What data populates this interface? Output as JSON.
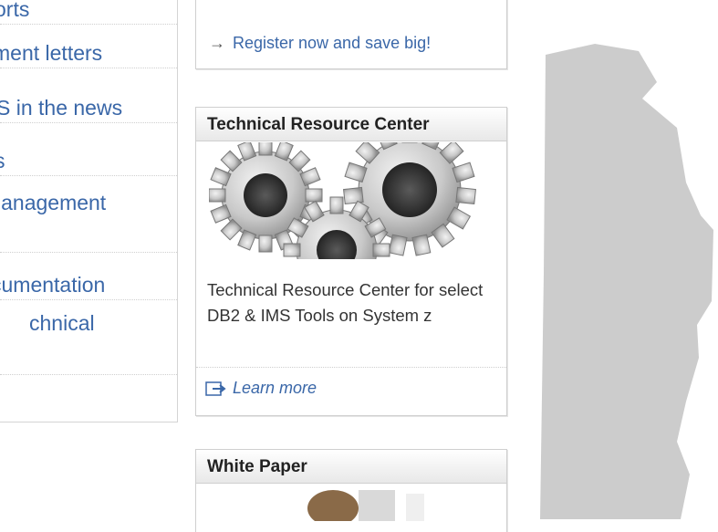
{
  "left_nav": {
    "items": [
      {
        "label": "orts"
      },
      {
        "label": "ment letters"
      },
      {
        "label": "S in the news"
      },
      {
        "label": "s"
      },
      {
        "label": "lanagement"
      },
      {
        "label": ""
      },
      {
        "label": "cumentation"
      },
      {
        "label": "chnical"
      }
    ]
  },
  "register": {
    "arrow": "→",
    "label": "Register now and save big!"
  },
  "technical_resource_center": {
    "title": "Technical Resource Center",
    "image_icon": "gears-image",
    "description": "Technical Resource Center for select DB2 & IMS Tools on System z",
    "learn_more": "Learn more"
  },
  "white_paper": {
    "title": "White Paper"
  },
  "colors": {
    "link": "#3a67a8",
    "gray_shape": "#cccccc",
    "border": "#cfcfcf"
  }
}
